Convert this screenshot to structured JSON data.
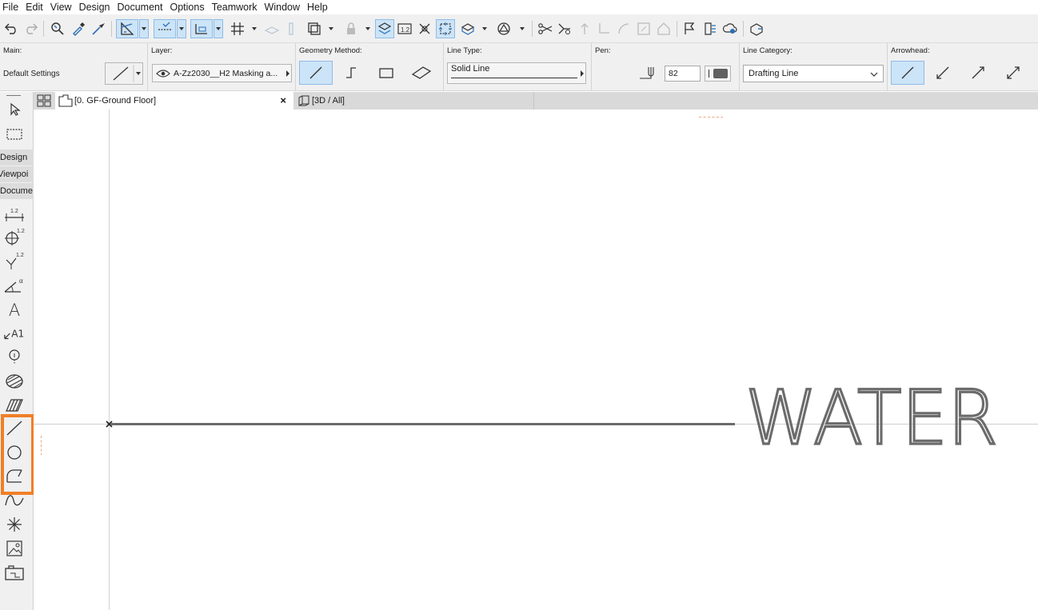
{
  "menu": [
    "File",
    "Edit",
    "View",
    "Design",
    "Document",
    "Options",
    "Teamwork",
    "Window",
    "Help"
  ],
  "infobox": {
    "main_label": "Main:",
    "main_value": "Default Settings",
    "layer_label": "Layer:",
    "layer_value": "A-Zz2030__H2 Masking a...",
    "geometry_label": "Geometry Method:",
    "linetype_label": "Line Type:",
    "linetype_value": "Solid Line",
    "pen_label": "Pen:",
    "pen_value": "82",
    "linecategory_label": "Line Category:",
    "linecategory_value": "Drafting Line",
    "arrowhead_label": "Arrowhead:"
  },
  "tabs": {
    "floor_plan": "[0. GF-Ground Floor]",
    "close": "×",
    "view_3d": "[3D / All]"
  },
  "toolbox": {
    "groups": [
      "Design",
      "Viewpoi",
      "Docume"
    ],
    "dimension_mark": "1.2",
    "angle_mark": "α",
    "text_tool": "A",
    "label_tool": "A1"
  },
  "canvas": {
    "drawing_text": "WATER",
    "colors": {
      "drawing": "#6b6b6b",
      "highlight": "#f07f27",
      "active": "#cce4f7"
    }
  }
}
